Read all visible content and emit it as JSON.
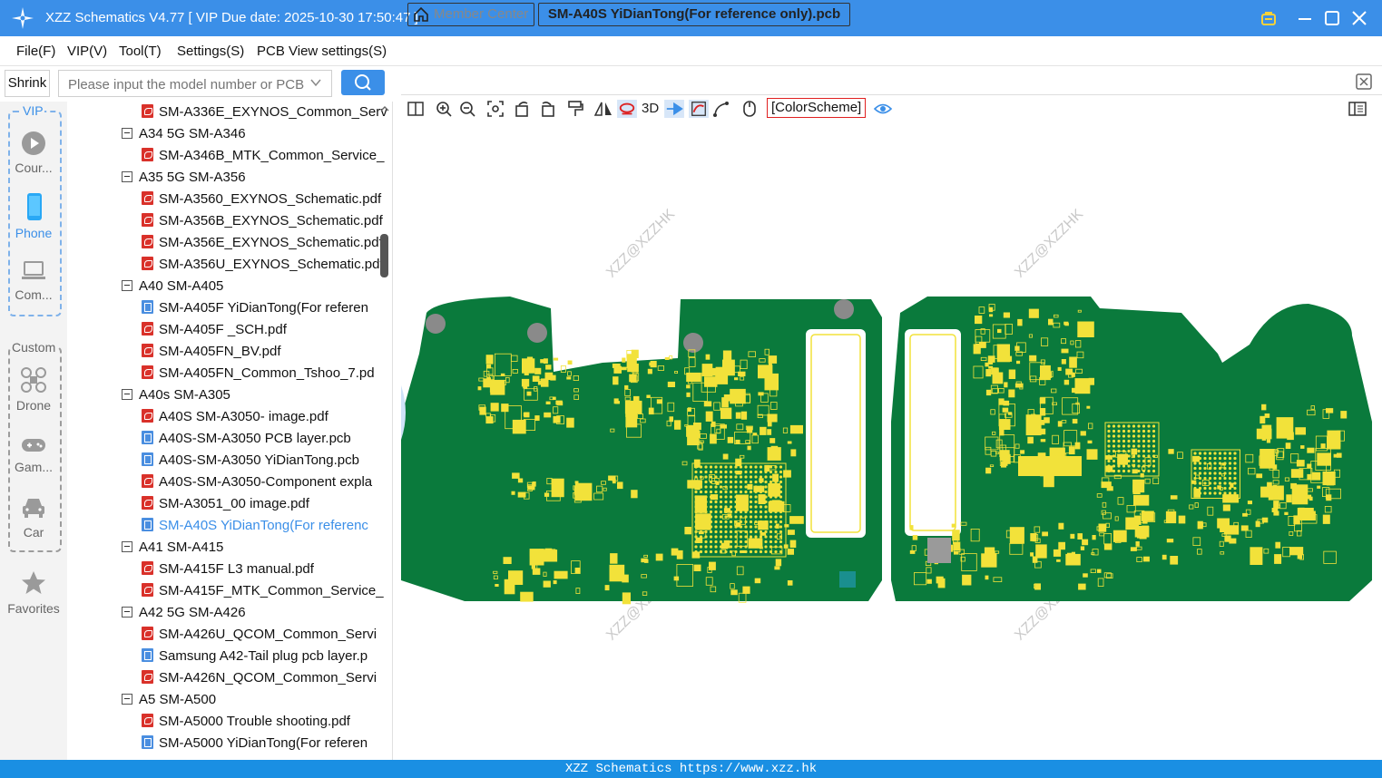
{
  "window": {
    "title": "XZZ Schematics V4.77 [ VIP Due date: 2025-10-30 17:50:47 ]"
  },
  "menu": [
    "File(F)",
    "VIP(V)",
    "Tool(T)",
    "Settings(S)",
    "PCB View settings(S)"
  ],
  "sidebar": {
    "shrink_label": "Shrink",
    "search_placeholder": "Please input the model number or PCB",
    "vip_label": "VIP",
    "vip_items": [
      "Cour...",
      "Phone",
      "Com..."
    ],
    "custom_label": "Custom",
    "custom_items": [
      "Drone",
      "Gam...",
      "Car"
    ],
    "favorites_label": "Favorites"
  },
  "tree": {
    "rows": [
      {
        "type": "file",
        "kind": "pdf",
        "label": "SM-A336E_EXYNOS_Common_Serv"
      },
      {
        "type": "group",
        "label": "A34 5G SM-A346"
      },
      {
        "type": "file",
        "kind": "pdf",
        "label": "SM-A346B_MTK_Common_Service_"
      },
      {
        "type": "group",
        "label": "A35 5G SM-A356"
      },
      {
        "type": "file",
        "kind": "pdf",
        "label": "SM-A3560_EXYNOS_Schematic.pdf"
      },
      {
        "type": "file",
        "kind": "pdf",
        "label": "SM-A356B_EXYNOS_Schematic.pdf"
      },
      {
        "type": "file",
        "kind": "pdf",
        "label": "SM-A356E_EXYNOS_Schematic.pdf"
      },
      {
        "type": "file",
        "kind": "pdf",
        "label": "SM-A356U_EXYNOS_Schematic.pdf"
      },
      {
        "type": "group",
        "label": "A40 SM-A405"
      },
      {
        "type": "file",
        "kind": "pcb",
        "label": "SM-A405F YiDianTong(For referen"
      },
      {
        "type": "file",
        "kind": "pdf",
        "label": "SM-A405F _SCH.pdf"
      },
      {
        "type": "file",
        "kind": "pdf",
        "label": "SM-A405FN_BV.pdf"
      },
      {
        "type": "file",
        "kind": "pdf",
        "label": "SM-A405FN_Common_Tshoo_7.pd"
      },
      {
        "type": "group",
        "label": "A40s SM-A305"
      },
      {
        "type": "file",
        "kind": "pdf",
        "label": "A40S SM-A3050- image.pdf"
      },
      {
        "type": "file",
        "kind": "pcb",
        "label": "A40S-SM-A3050 PCB layer.pcb"
      },
      {
        "type": "file",
        "kind": "pcb",
        "label": "A40S-SM-A3050 YiDianTong.pcb"
      },
      {
        "type": "file",
        "kind": "pdf",
        "label": "A40S-SM-A3050-Component expla"
      },
      {
        "type": "file",
        "kind": "pdf",
        "label": "SM-A3051_00 image.pdf"
      },
      {
        "type": "file",
        "kind": "pcb",
        "label": "SM-A40S YiDianTong(For referenc",
        "selected": true
      },
      {
        "type": "group",
        "label": "A41 SM-A415"
      },
      {
        "type": "file",
        "kind": "pdf",
        "label": "SM-A415F L3 manual.pdf"
      },
      {
        "type": "file",
        "kind": "pdf",
        "label": "SM-A415F_MTK_Common_Service_"
      },
      {
        "type": "group",
        "label": "A42 5G SM-A426"
      },
      {
        "type": "file",
        "kind": "pdf",
        "label": "SM-A426U_QCOM_Common_Servi"
      },
      {
        "type": "file",
        "kind": "pcb",
        "label": "Samsung A42-Tail plug pcb layer.p"
      },
      {
        "type": "file",
        "kind": "pdf",
        "label": "SM-A426N_QCOM_Common_Servi"
      },
      {
        "type": "group",
        "label": "A5 SM-A500"
      },
      {
        "type": "file",
        "kind": "pdf",
        "label": "SM-A5000 Trouble shooting.pdf"
      },
      {
        "type": "file",
        "kind": "pcb",
        "label": "SM-A5000 YiDianTong(For referen"
      }
    ]
  },
  "tabs": {
    "member_center": "Member Center",
    "active_tab": "SM-A40S YiDianTong(For reference only).pcb"
  },
  "toolbar": {
    "label_3d": "3D",
    "color_scheme": "[ColorScheme]"
  },
  "viewer": {
    "watermark": "XZZ@XZZHK",
    "board_color": "#0a7a3c",
    "pad_color": "#f2e23a"
  },
  "status": {
    "text": "XZZ Schematics https://www.xzz.hk"
  },
  "colors": {
    "accent": "#3b8fe8",
    "status_bar": "#1a8fe3"
  }
}
